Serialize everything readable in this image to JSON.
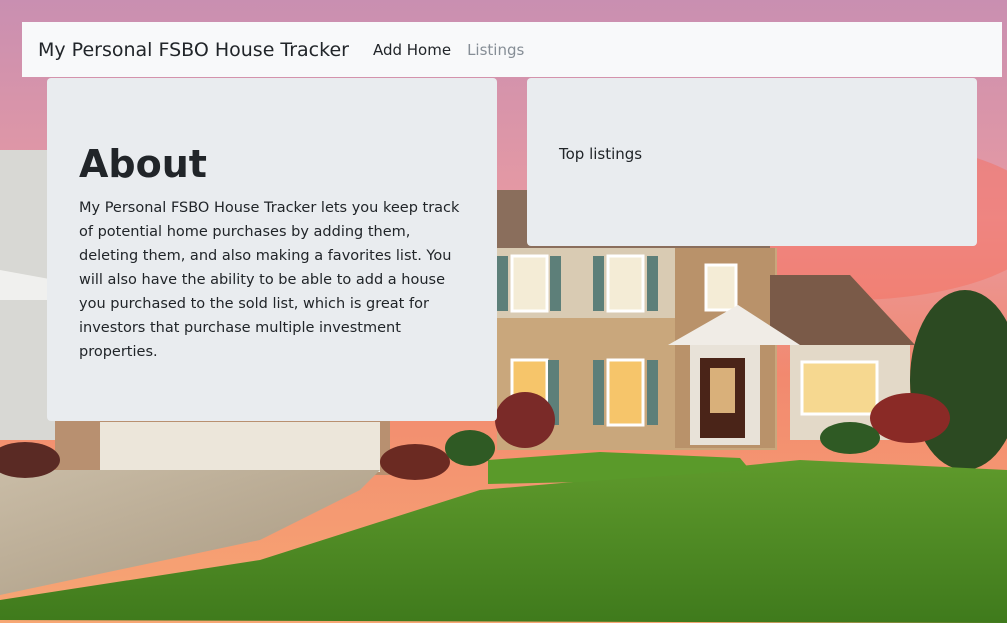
{
  "navbar": {
    "brand": "My Personal FSBO House Tracker",
    "links": [
      {
        "label": "Add Home",
        "state": "active"
      },
      {
        "label": "Listings",
        "state": "muted"
      }
    ]
  },
  "about": {
    "title": "About",
    "text": "My Personal FSBO House Tracker lets you keep track of potential home purchases by adding them, deleting them, and also making a favorites list. You will also have the ability to be able to add a house you purchased to the sold list, which is great for investors that purchase multiple investment properties."
  },
  "top_listings": {
    "title": "Top listings"
  },
  "colors": {
    "navbar_bg": "#f8f9fa",
    "card_bg": "#e9ecef",
    "text": "#212529",
    "muted_link": "#868e96"
  }
}
